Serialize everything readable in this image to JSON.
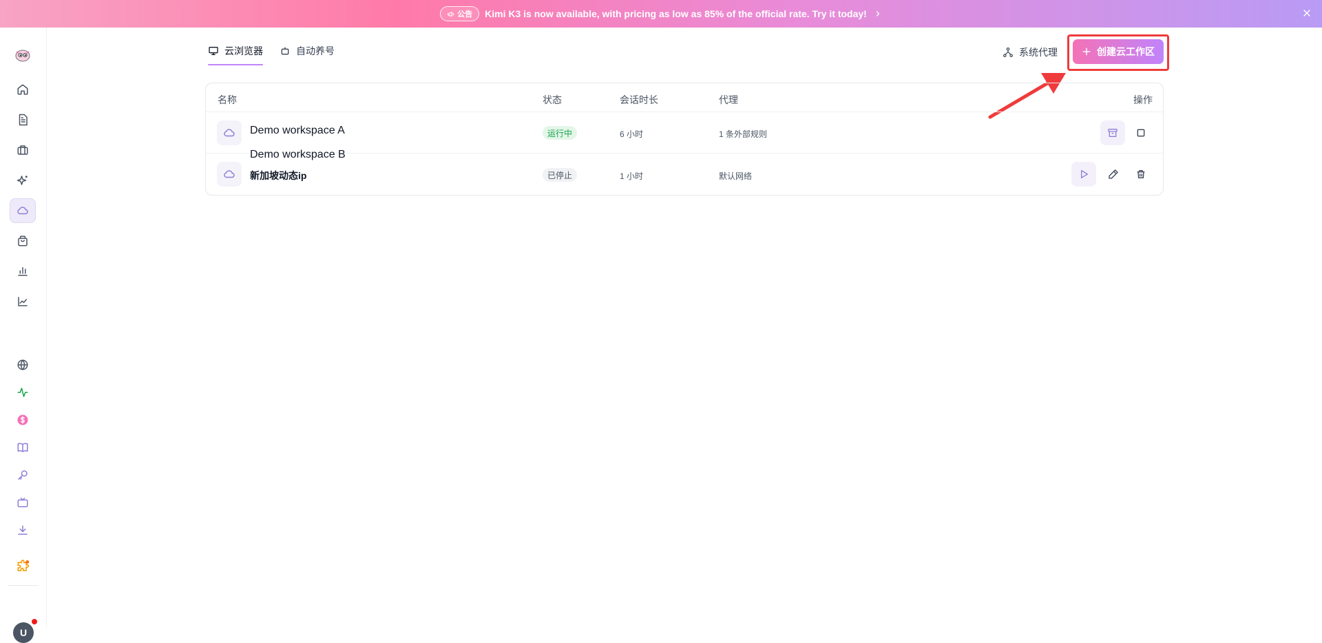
{
  "banner": {
    "badge_label": "公告",
    "message": "Kimi K3 is now available, with pricing as low as 85% of the official rate. Try it today!"
  },
  "sidebar": {
    "avatar_initial": "U",
    "icons": [
      "logo-icon",
      "home-icon",
      "document-icon",
      "briefcase-icon",
      "sparkles-icon",
      "cloud-icon",
      "shopping-bag-icon",
      "bar-chart-icon",
      "line-chart-icon",
      "globe-icon",
      "activity-icon",
      "dollar-icon",
      "book-icon",
      "key-icon",
      "tv-icon",
      "download-icon",
      "puzzle-icon"
    ]
  },
  "tabs": [
    {
      "label": "云浏览器",
      "active": true
    },
    {
      "label": "自动养号",
      "active": false
    }
  ],
  "toolbar": {
    "proxy_label": "系统代理",
    "create_label": "创建云工作区"
  },
  "table": {
    "headers": [
      "名称",
      "状态",
      "会话时长",
      "代理",
      "操作"
    ],
    "rows": [
      {
        "name": "Demo workspace A",
        "status": "运行中",
        "duration": "6 小时",
        "proxy": "1 条外部规则"
      },
      {
        "name": "Demo workspace B",
        "subname": "新加坡动态ip",
        "status": "已停止",
        "duration": "1 小时",
        "proxy": "默认网络"
      }
    ]
  },
  "colors": {
    "accent_pink": "#f472b6",
    "accent_purple": "#c084fc",
    "highlight_red": "#ef3b3b",
    "running_green": "#16a34a"
  }
}
